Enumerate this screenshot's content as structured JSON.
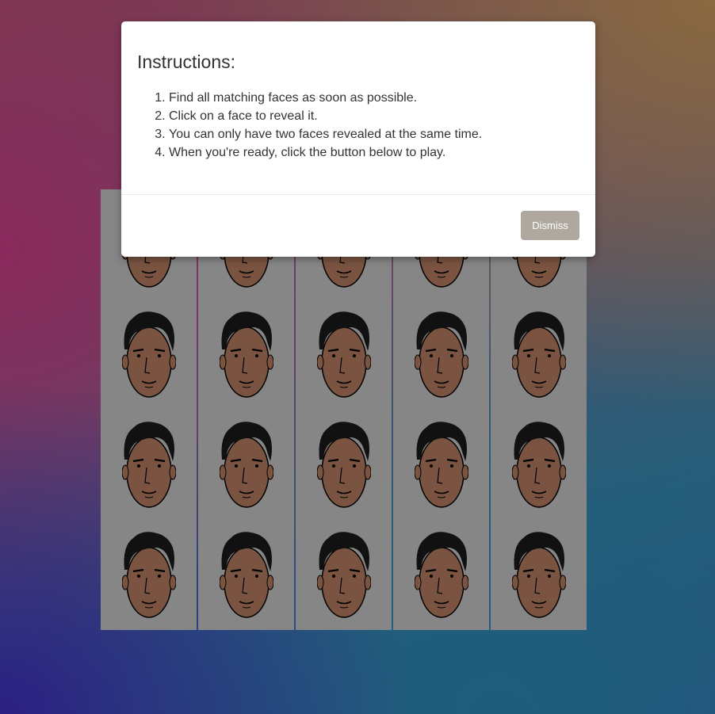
{
  "modal": {
    "title": "Instructions:",
    "instructions": [
      "Find all matching faces as soon as possible.",
      "Click on a face to reveal it.",
      "You can only have two faces revealed at the same time.",
      "When you're ready, click the button below to play."
    ],
    "dismiss_label": "Dismiss"
  },
  "board": {
    "rows": 4,
    "columns": 5,
    "card_back_icon": "face-icon",
    "colors": {
      "card": "#868686",
      "skin": "#7a5441",
      "hair": "#111111"
    }
  }
}
